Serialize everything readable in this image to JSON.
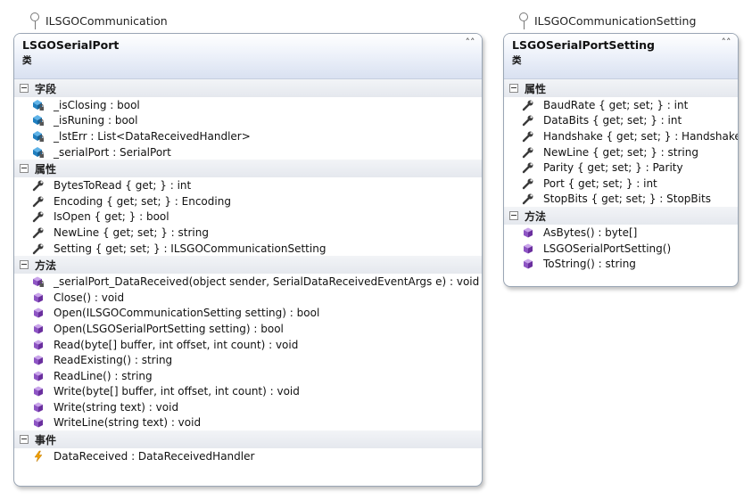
{
  "interfaces": {
    "left": "ILSGOCommunication",
    "right": "ILSGOCommunicationSetting"
  },
  "classes": {
    "serial_port": {
      "name": "LSGOSerialPort",
      "stereotype": "类",
      "sections": {
        "fields": {
          "title": "字段",
          "items": [
            {
              "text": "_isClosing : bool",
              "icon": "private-field-icon"
            },
            {
              "text": "_isRuning : bool",
              "icon": "private-field-icon"
            },
            {
              "text": "_lstErr : List<DataReceivedHandler>",
              "icon": "private-field-icon"
            },
            {
              "text": "_serialPort : SerialPort",
              "icon": "private-field-icon"
            }
          ]
        },
        "properties": {
          "title": "属性",
          "items": [
            {
              "text": "BytesToRead { get; } : int",
              "icon": "property-wrench-icon"
            },
            {
              "text": "Encoding { get; set; } : Encoding",
              "icon": "property-wrench-icon"
            },
            {
              "text": "IsOpen { get; } : bool",
              "icon": "property-wrench-icon"
            },
            {
              "text": "NewLine { get; set; } : string",
              "icon": "property-wrench-icon"
            },
            {
              "text": "Setting { get; set; } : ILSGOCommunicationSetting",
              "icon": "property-wrench-icon"
            }
          ]
        },
        "methods": {
          "title": "方法",
          "items": [
            {
              "text": "_serialPort_DataReceived(object sender, SerialDataReceivedEventArgs e) : void",
              "icon": "private-method-icon"
            },
            {
              "text": "Close() : void",
              "icon": "method-cube-icon"
            },
            {
              "text": "Open(ILSGOCommunicationSetting setting) : bool",
              "icon": "method-cube-icon"
            },
            {
              "text": "Open(LSGOSerialPortSetting setting) : bool",
              "icon": "method-cube-icon"
            },
            {
              "text": "Read(byte[] buffer, int offset, int count) : void",
              "icon": "method-cube-icon"
            },
            {
              "text": "ReadExisting() : string",
              "icon": "method-cube-icon"
            },
            {
              "text": "ReadLine() : string",
              "icon": "method-cube-icon"
            },
            {
              "text": "Write(byte[] buffer, int offset, int count) : void",
              "icon": "method-cube-icon"
            },
            {
              "text": "Write(string text) : void",
              "icon": "method-cube-icon"
            },
            {
              "text": "WriteLine(string text) : void",
              "icon": "method-cube-icon"
            }
          ]
        },
        "events": {
          "title": "事件",
          "items": [
            {
              "text": "DataReceived : DataReceivedHandler",
              "icon": "event-lightning-icon"
            }
          ]
        }
      }
    },
    "serial_port_setting": {
      "name": "LSGOSerialPortSetting",
      "stereotype": "类",
      "sections": {
        "properties": {
          "title": "属性",
          "items": [
            {
              "text": "BaudRate { get; set; } : int",
              "icon": "property-wrench-icon"
            },
            {
              "text": "DataBits { get; set; } : int",
              "icon": "property-wrench-icon"
            },
            {
              "text": "Handshake { get; set; } : Handshake",
              "icon": "property-wrench-icon"
            },
            {
              "text": "NewLine { get; set; } : string",
              "icon": "property-wrench-icon"
            },
            {
              "text": "Parity { get; set; } : Parity",
              "icon": "property-wrench-icon"
            },
            {
              "text": "Port { get; set; } : int",
              "icon": "property-wrench-icon"
            },
            {
              "text": "StopBits { get; set; } : StopBits",
              "icon": "property-wrench-icon"
            }
          ]
        },
        "methods": {
          "title": "方法",
          "items": [
            {
              "text": "AsBytes() : byte[]",
              "icon": "method-cube-icon"
            },
            {
              "text": "LSGOSerialPortSetting()",
              "icon": "method-cube-icon"
            },
            {
              "text": "ToString() : string",
              "icon": "method-cube-icon"
            }
          ]
        }
      }
    }
  },
  "colors": {
    "border": "#9aa6b5",
    "header_gradient_end": "#d9e1f1",
    "field_icon": "#1f7fc0",
    "property_icon": "#3a3a3a",
    "method_icon": "#7a3fb0",
    "event_icon": "#f0a000"
  }
}
